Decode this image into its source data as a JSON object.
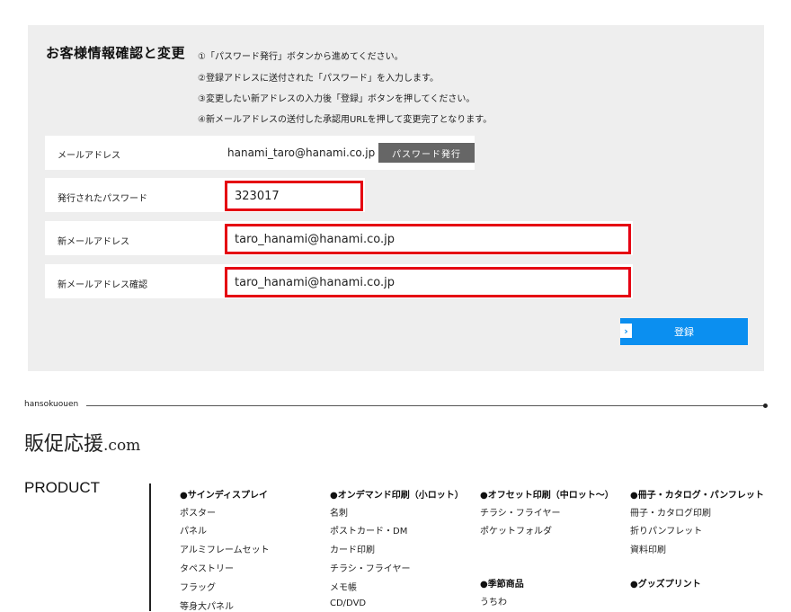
{
  "form": {
    "title": "お客様情報確認と変更",
    "steps": [
      "①「パスワード発行」ボタンから進めてください。",
      "②登録アドレスに送付された「パスワード」を入力します。",
      "③変更したい新アドレスの入力後「登録」ボタンを押してください。",
      "④新メールアドレスの送付した承認用URLを押して変更完了となります。"
    ],
    "rows": {
      "email": {
        "label": "メールアドレス",
        "value": "hanami_taro@hanami.co.jp",
        "button": "パスワード発行"
      },
      "password": {
        "label": "発行されたパスワード",
        "value": "323017"
      },
      "new_email": {
        "label": "新メールアドレス",
        "value": "taro_hanami@hanami.co.jp"
      },
      "new_email_confirm": {
        "label": "新メールアドレス確認",
        "value": "taro_hanami@hanami.co.jp"
      }
    },
    "register_button": "登録",
    "register_arrow": "›"
  },
  "footer": {
    "brand_small": "hansokuouen",
    "logo_main": "販促応援",
    "logo_suffix": ".com",
    "product_heading": "PRODUCT",
    "columns": [
      {
        "heading": "●サインディスプレイ",
        "items": [
          "ポスター",
          "パネル",
          "アルミフレームセット",
          "タペストリー",
          "フラッグ",
          "等身大パネル"
        ]
      },
      {
        "heading": "●オンデマンド印刷（小ロット）",
        "items": [
          "名刺",
          "ポストカード・DM",
          "カード印刷",
          "チラシ・フライヤー",
          "メモ帳",
          "CD/DVD"
        ]
      },
      {
        "heading": "●オフセット印刷（中ロット〜）",
        "items": [
          "チラシ・フライヤー",
          "ポケットフォルダ"
        ],
        "heading2": "●季節商品",
        "items2": [
          "うちわ"
        ]
      },
      {
        "heading": "●冊子・カタログ・パンフレット",
        "items": [
          "冊子・カタログ印刷",
          "折りパンフレット",
          "資料印刷"
        ],
        "heading2": "●グッズプリント"
      }
    ]
  },
  "colors": {
    "panel_bg": "#eeeeee",
    "highlight_border": "#e50012",
    "register_button": "#0b8ff0",
    "issue_button": "#666666"
  }
}
